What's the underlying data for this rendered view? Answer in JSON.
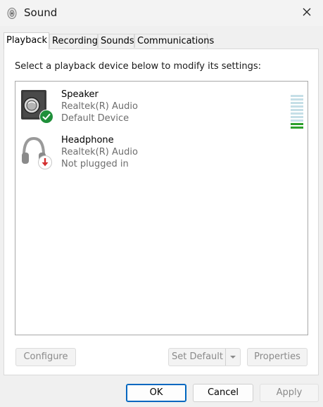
{
  "window": {
    "title": "Sound"
  },
  "tabs": [
    {
      "label": "Playback",
      "active": true
    },
    {
      "label": "Recording",
      "active": false
    },
    {
      "label": "Sounds",
      "active": false
    },
    {
      "label": "Communications",
      "active": false
    }
  ],
  "playback": {
    "instruction": "Select a playback device below to modify its settings:",
    "devices": [
      {
        "name": "Speaker",
        "driver": "Realtek(R) Audio",
        "status": "Default Device",
        "icon": "speaker-icon",
        "badge": "default-check-icon",
        "level_meter_segments": 10,
        "level_meter_active": 2
      },
      {
        "name": "Headphone",
        "driver": "Realtek(R) Audio",
        "status": "Not plugged in",
        "icon": "headphone-icon",
        "badge": "unplugged-arrow-icon"
      }
    ],
    "buttons": {
      "configure": {
        "label": "Configure",
        "enabled": false
      },
      "set_default": {
        "label": "Set Default",
        "enabled": false
      },
      "properties": {
        "label": "Properties",
        "enabled": false
      }
    }
  },
  "footer": {
    "ok": "OK",
    "cancel": "Cancel",
    "apply": {
      "label": "Apply",
      "enabled": false
    }
  },
  "colors": {
    "accent": "#0067c0",
    "check": "#1f8f3a",
    "unplugged": "#d32f2f",
    "meter_on": "#2ca02c",
    "meter_off": "#c6dfe7"
  }
}
